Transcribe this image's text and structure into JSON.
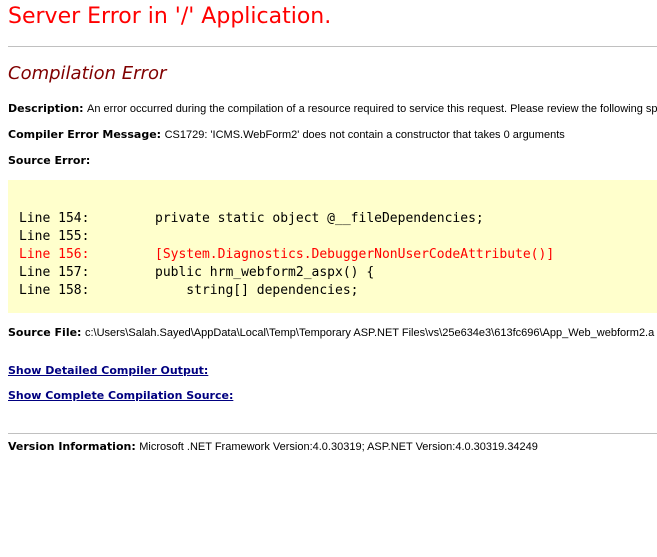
{
  "page": {
    "title": "Server Error in '/' Application.",
    "subtitle": "Compilation Error"
  },
  "description": {
    "label": "Description:",
    "text": "An error occurred during the compilation of a resource required to service this request. Please review the following sp"
  },
  "compiler_error_message": {
    "label": "Compiler Error Message:",
    "text": "CS1729: 'ICMS.WebForm2' does not contain a constructor that takes 0 arguments"
  },
  "source_error": {
    "label": "Source Error:",
    "lines": [
      {
        "number": "Line 154:",
        "code": "private static object @__fileDependencies;",
        "error": false
      },
      {
        "number": "Line 155:",
        "code": "",
        "error": false
      },
      {
        "number": "Line 156:",
        "code": "[System.Diagnostics.DebuggerNonUserCodeAttribute()]",
        "error": true
      },
      {
        "number": "Line 157:",
        "code": "public hrm_webform2_aspx() {",
        "error": false
      },
      {
        "number": "Line 158:",
        "code": "    string[] dependencies;",
        "error": false
      }
    ]
  },
  "source_file": {
    "label": "Source File:",
    "path": "c:\\Users\\Salah.Sayed\\AppData\\Local\\Temp\\Temporary ASP.NET Files\\vs\\25e634e3\\613fc696\\App_Web_webform2.a"
  },
  "links": {
    "compiler_output": "Show Detailed Compiler Output:",
    "compilation_source": "Show Complete Compilation Source:"
  },
  "version_info": {
    "label": "Version Information:",
    "text": "Microsoft .NET Framework Version:4.0.30319; ASP.NET Version:4.0.30319.34249"
  },
  "colors": {
    "title": "#ff0000",
    "subtitle": "#800000",
    "code_background": "#ffffcc",
    "error_line": "#ff0000",
    "link": "#000080"
  }
}
